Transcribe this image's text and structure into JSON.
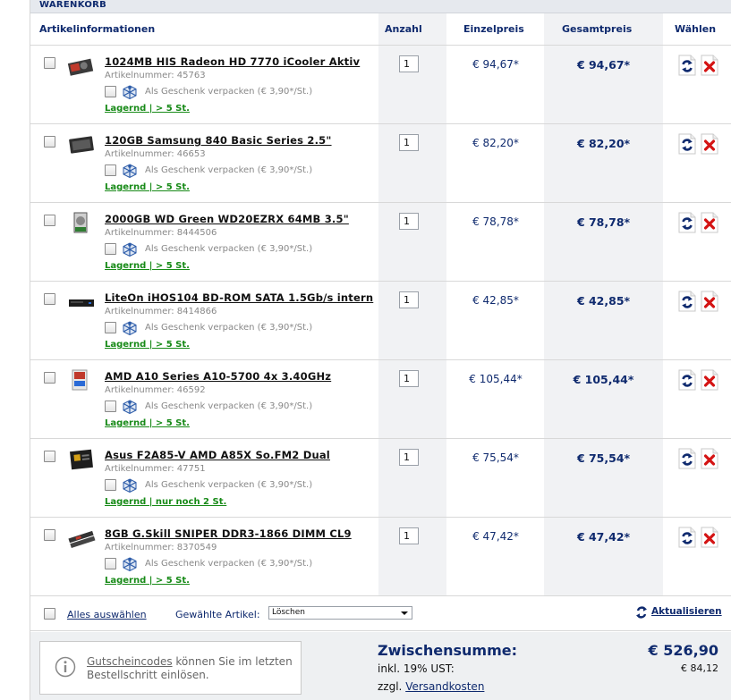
{
  "title": "WARENKORB",
  "columns": {
    "info": "Artikelinformationen",
    "qty": "Anzahl",
    "unit": "Einzelpreis",
    "total": "Gesamtpreis",
    "choose": "Wählen"
  },
  "gift_label": "Als Geschenk verpacken (€ 3,90*/St.)",
  "items": [
    {
      "name": "1024MB HIS Radeon HD 7770 iCooler Aktiv",
      "artnr": "Artikelnummer: 45763",
      "stock": "Lagernd | > 5 St.",
      "qty": "1",
      "unit_price": "€ 94,67*",
      "total_price": "€ 94,67*",
      "thumb": "graphics-card"
    },
    {
      "name": "120GB Samsung 840 Basic Series 2.5\"",
      "artnr": "Artikelnummer: 46653",
      "stock": "Lagernd | > 5 St.",
      "qty": "1",
      "unit_price": "€ 82,20*",
      "total_price": "€ 82,20*",
      "thumb": "ssd"
    },
    {
      "name": "2000GB WD Green WD20EZRX 64MB 3.5\"",
      "artnr": "Artikelnummer: 8444506",
      "stock": "Lagernd | > 5 St.",
      "qty": "1",
      "unit_price": "€ 78,78*",
      "total_price": "€ 78,78*",
      "thumb": "hard-drive"
    },
    {
      "name": "LiteOn iHOS104 BD-ROM SATA 1.5Gb/s intern",
      "artnr": "Artikelnummer: 8414866",
      "stock": "Lagernd | > 5 St.",
      "qty": "1",
      "unit_price": "€ 42,85*",
      "total_price": "€ 42,85*",
      "thumb": "optical-drive"
    },
    {
      "name": "AMD A10 Series A10-5700 4x 3.40GHz",
      "artnr": "Artikelnummer: 46592",
      "stock": "Lagernd | > 5 St.",
      "qty": "1",
      "unit_price": "€ 105,44*",
      "total_price": "€ 105,44*",
      "thumb": "cpu-box"
    },
    {
      "name": "Asus F2A85-V AMD A85X So.FM2 Dual",
      "artnr": "Artikelnummer: 47751",
      "stock": "Lagernd | nur noch 2 St.",
      "qty": "1",
      "unit_price": "€ 75,54*",
      "total_price": "€ 75,54*",
      "thumb": "motherboard"
    },
    {
      "name": "8GB G.Skill SNIPER DDR3-1866 DIMM CL9",
      "artnr": "Artikelnummer: 8370549",
      "stock": "Lagernd | > 5 St.",
      "qty": "1",
      "unit_price": "€ 47,42*",
      "total_price": "€ 47,42*",
      "thumb": "ram"
    }
  ],
  "actions": {
    "select_all": "Alles auswählen",
    "selected_items": "Gewählte Artikel:",
    "action_value": "Löschen",
    "update": "Aktualisieren"
  },
  "footer": {
    "voucher_link": "Gutscheincodes",
    "voucher_text": " können Sie im letzten Bestellschritt einlösen.",
    "subtotal_label": "Zwischensumme:",
    "subtotal_value": "€ 526,90",
    "vat_label": "inkl. 19% UST:",
    "vat_value": "€ 84,12",
    "shipping_prefix": "zzgl. ",
    "shipping_link": "Versandkosten"
  },
  "colors": {
    "accent": "#0f2a6e",
    "stock": "#178a17",
    "delete": "#d41414"
  }
}
